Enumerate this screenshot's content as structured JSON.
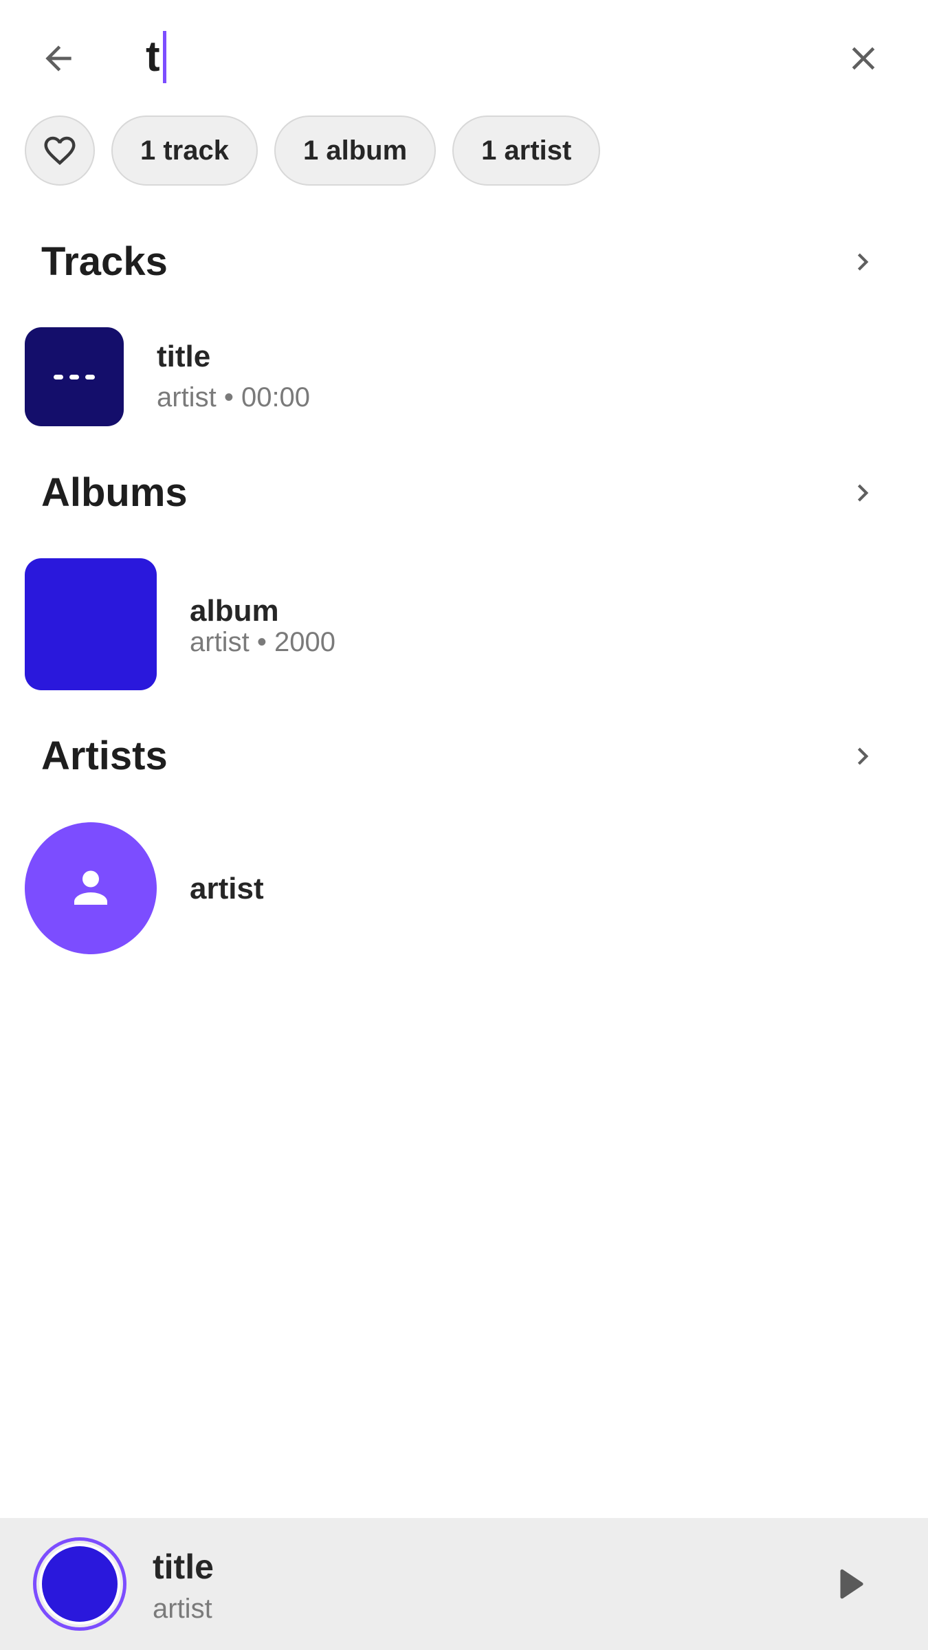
{
  "search": {
    "value": "t",
    "back_icon": "arrow-left-icon",
    "clear_icon": "close-icon"
  },
  "filters": {
    "favorite_icon": "heart-outline-icon",
    "chips": [
      "1 track",
      "1 album",
      "1 artist"
    ]
  },
  "sections": {
    "tracks": {
      "title": "Tracks",
      "items": [
        {
          "title": "title",
          "artist": "artist",
          "separator": "•",
          "duration": "00:00",
          "art_color": "#140e6b"
        }
      ]
    },
    "albums": {
      "title": "Albums",
      "items": [
        {
          "title": "album",
          "artist": "artist",
          "separator": "•",
          "year": "2000",
          "art_color": "#2a18dc"
        }
      ]
    },
    "artists": {
      "title": "Artists",
      "items": [
        {
          "name": "artist",
          "avatar_color": "#7c4dff",
          "avatar_icon": "person-icon"
        }
      ]
    }
  },
  "player": {
    "title": "title",
    "artist": "artist",
    "art_color": "#2a18dc",
    "ring_color": "#7c4dff",
    "play_icon": "play-icon"
  },
  "colors": {
    "accent": "#7c4dff",
    "chip_bg": "#efefef",
    "player_bg": "#ededed"
  }
}
